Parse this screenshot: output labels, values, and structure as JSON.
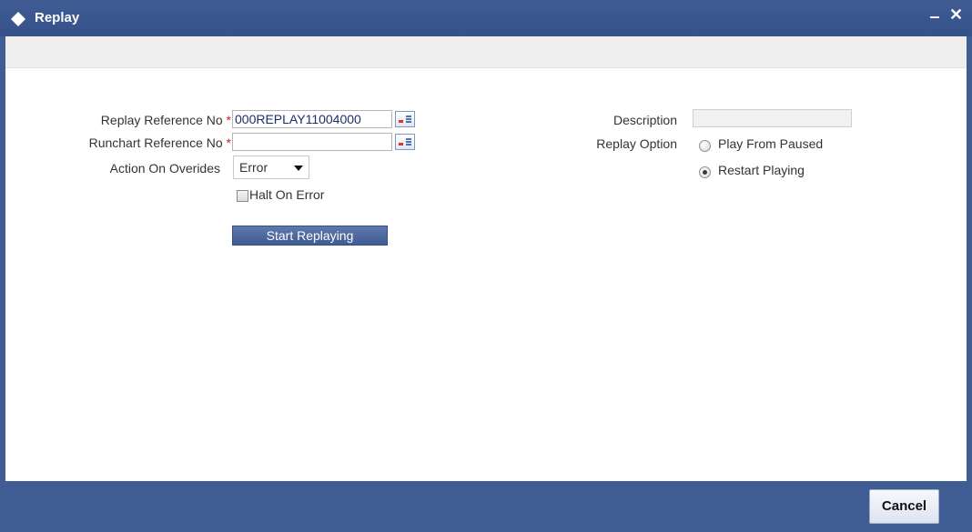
{
  "window": {
    "title": "Replay",
    "minimize_glyph": "‒",
    "close_glyph": "✕"
  },
  "form": {
    "replay_ref": {
      "label": "Replay Reference No",
      "required_mark": "*",
      "value": "000REPLAY11004000"
    },
    "runchart_ref": {
      "label": "Runchart Reference No",
      "required_mark": "*",
      "value": ""
    },
    "action_on_overides": {
      "label": "Action On Overides",
      "selected": "Error"
    },
    "halt_on_error": {
      "label": "Halt On Error",
      "checked": false
    },
    "start_button": "Start Replaying",
    "description": {
      "label": "Description",
      "value": ""
    },
    "replay_option": {
      "label": "Replay Option",
      "options": [
        {
          "label": "Play From Paused",
          "checked": false
        },
        {
          "label": "Restart Playing",
          "checked": true
        }
      ]
    }
  },
  "footer": {
    "cancel_label": "Cancel"
  },
  "colors": {
    "titlebar": "#3f5c93",
    "footer": "#3f5c93",
    "required": "#cc2222",
    "field_text": "#1a2f6b"
  },
  "icons": {
    "title": "diamond-icon",
    "lov": "list-of-values-icon"
  }
}
